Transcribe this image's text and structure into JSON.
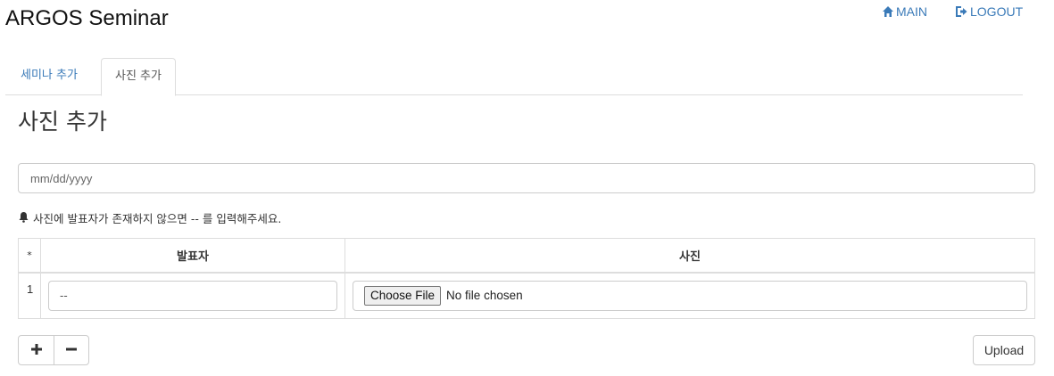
{
  "header": {
    "title": "ARGOS Seminar",
    "nav": [
      {
        "label": "MAIN",
        "icon": "home-icon"
      },
      {
        "label": "LOGOUT",
        "icon": "logout-icon"
      }
    ]
  },
  "tabs": [
    {
      "label": "세미나 추가",
      "active": false
    },
    {
      "label": "사진 추가",
      "active": true
    }
  ],
  "section": {
    "heading": "사진 추가",
    "date_placeholder": "mm/dd/yyyy",
    "notice": "사진에 발표자가 존재하지 않으면 -- 를 입력해주세요.",
    "notice_icon": "bell-icon"
  },
  "table": {
    "columns": [
      "*",
      "발표자",
      "사진"
    ],
    "rows": [
      {
        "index": "1",
        "speaker": "--",
        "file_button": "Choose File",
        "file_status": "No file chosen"
      }
    ]
  },
  "actions": {
    "add_icon": "plus-icon",
    "remove_icon": "minus-icon",
    "upload_label": "Upload"
  },
  "colors": {
    "link": "#3a7ab8",
    "border": "#dddddd"
  }
}
